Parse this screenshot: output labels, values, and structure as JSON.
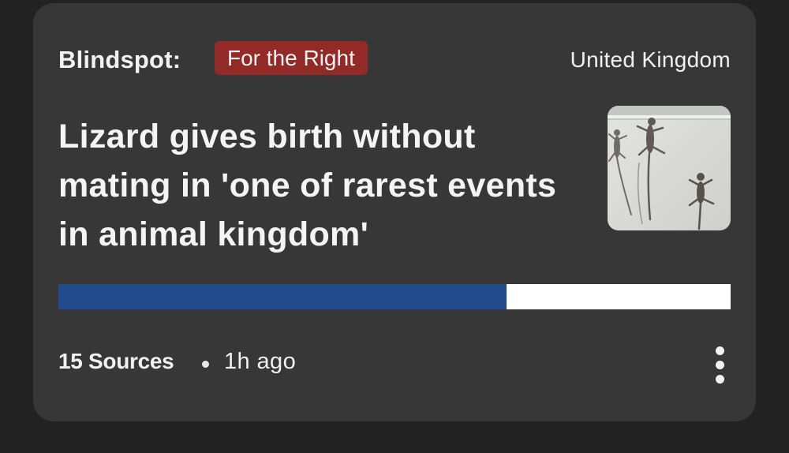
{
  "card": {
    "blindspot_label": "Blindspot:",
    "blindspot_badge": "For the Right",
    "region": "United Kingdom",
    "headline": "Lizard gives birth without mating in 'one of rarest events in animal kingdom'",
    "thumbnail_icon": "lizard-photo",
    "bias": {
      "left_fraction": 0.667,
      "left_color": "#214b8d",
      "right_color": "#ffffff"
    },
    "sources": "15 Sources",
    "separator": "•",
    "time_ago": "1h ago",
    "more_icon": "more-vertical-icon"
  },
  "colors": {
    "background": "#222222",
    "card": "#373737",
    "badge": "#922a27",
    "text": "#f2f2f2"
  }
}
